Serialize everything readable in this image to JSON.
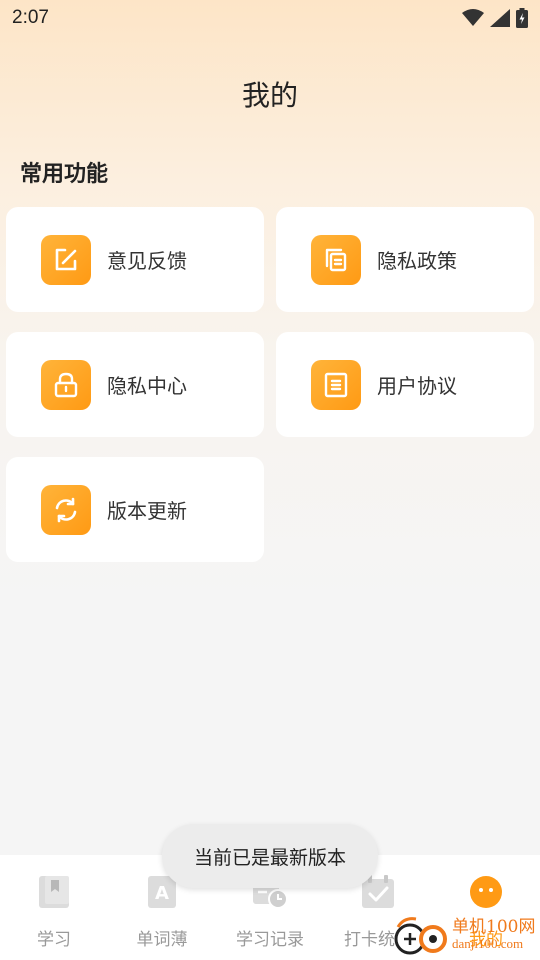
{
  "status_bar": {
    "time": "2:07"
  },
  "page": {
    "title": "我的"
  },
  "section": {
    "title": "常用功能"
  },
  "features": [
    {
      "label": "意见反馈",
      "icon": "edit-icon"
    },
    {
      "label": "隐私政策",
      "icon": "copy-icon"
    },
    {
      "label": "隐私中心",
      "icon": "lock-icon"
    },
    {
      "label": "用户协议",
      "icon": "document-icon"
    },
    {
      "label": "版本更新",
      "icon": "refresh-icon"
    }
  ],
  "toast": {
    "text": "当前已是最新版本"
  },
  "tabbar": {
    "items": [
      {
        "label": "学习",
        "icon": "book-icon",
        "active": false
      },
      {
        "label": "单词薄",
        "icon": "word-book-icon",
        "active": false
      },
      {
        "label": "学习记录",
        "icon": "record-clock-icon",
        "active": false
      },
      {
        "label": "打卡统计",
        "icon": "calendar-check-icon",
        "active": false
      },
      {
        "label": "我的",
        "icon": "profile-face-icon",
        "active": true
      }
    ]
  },
  "watermark": {
    "name": "单机100网",
    "url": "danji100.com"
  },
  "colors": {
    "accent": "#ff9a14",
    "inactive": "#999999"
  }
}
